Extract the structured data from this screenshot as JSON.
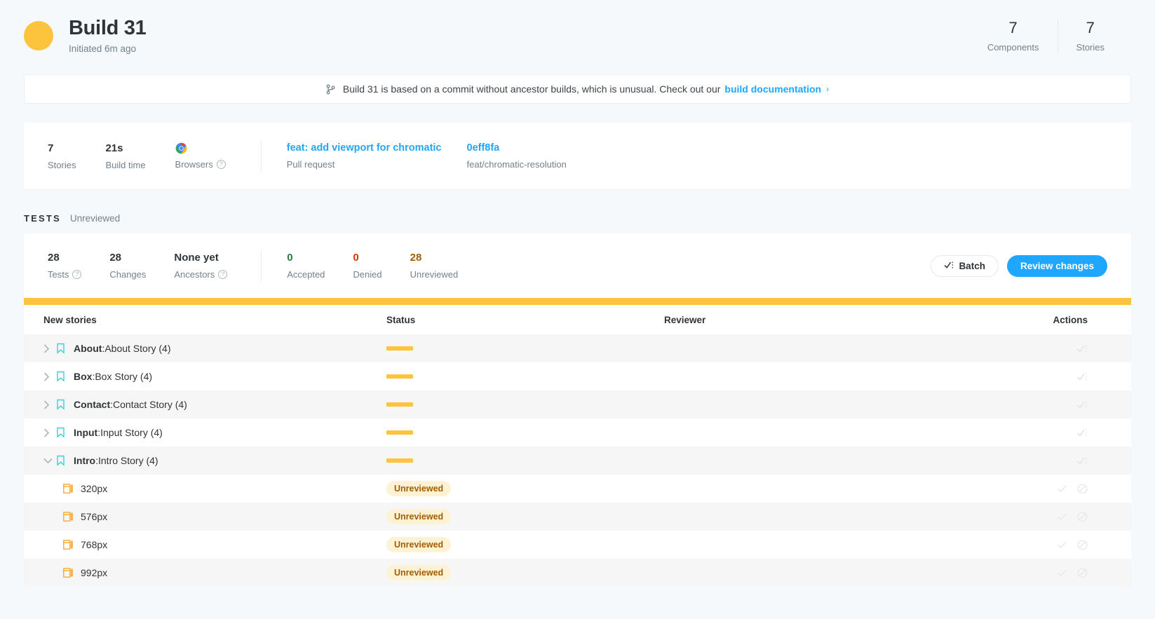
{
  "header": {
    "title": "Build 31",
    "subtitle": "Initiated 6m ago",
    "status_color": "#fcc43d",
    "stats": [
      {
        "value": "7",
        "label": "Components"
      },
      {
        "value": "7",
        "label": "Stories"
      }
    ]
  },
  "notice": {
    "icon": "branch-icon",
    "text": "Build 31 is based on a commit without ancestor builds, which is unusual. Check out our",
    "link_label": "build documentation",
    "chevron": "›"
  },
  "info_card": {
    "stats": [
      {
        "value": "7",
        "label": "Stories"
      },
      {
        "value": "21s",
        "label": "Build time"
      }
    ],
    "browsers": {
      "label": "Browsers",
      "icon": "chrome-icon",
      "help": "?"
    },
    "commit": {
      "title": "feat: add viewport for chromatic",
      "subtitle": "Pull request"
    },
    "branch": {
      "title": "0eff8fa",
      "subtitle": "feat/chromatic-resolution"
    }
  },
  "tests": {
    "heading": "TESTS",
    "state": "Unreviewed",
    "counters": [
      {
        "value": "28",
        "label": "Tests",
        "help": "?",
        "tone": "default"
      },
      {
        "value": "28",
        "label": "Changes",
        "help": "",
        "tone": "default"
      },
      {
        "value": "None yet",
        "label": "Ancestors",
        "help": "?",
        "tone": "default"
      },
      {
        "value": "0",
        "label": "Accepted",
        "help": "",
        "tone": "accepted"
      },
      {
        "value": "0",
        "label": "Denied",
        "help": "",
        "tone": "denied"
      },
      {
        "value": "28",
        "label": "Unreviewed",
        "help": "",
        "tone": "unreviewed"
      }
    ],
    "batch_button": "Batch",
    "review_button": "Review changes",
    "progress_color": "#fcc43d"
  },
  "table": {
    "columns": {
      "name": "New stories",
      "status": "Status",
      "reviewer": "Reviewer",
      "actions": "Actions"
    },
    "rows": [
      {
        "type": "group",
        "expanded": false,
        "component": "About",
        "story": "About Story (4)",
        "status": "bar",
        "alt": true
      },
      {
        "type": "group",
        "expanded": false,
        "component": "Box",
        "story": "Box Story (4)",
        "status": "bar",
        "alt": false
      },
      {
        "type": "group",
        "expanded": false,
        "component": "Contact",
        "story": "Contact Story (4)",
        "status": "bar",
        "alt": true
      },
      {
        "type": "group",
        "expanded": false,
        "component": "Input",
        "story": "Input Story (4)",
        "status": "bar",
        "alt": false
      },
      {
        "type": "group",
        "expanded": true,
        "component": "Intro",
        "story": "Intro Story (4)",
        "status": "bar",
        "alt": true
      },
      {
        "type": "child",
        "viewport": "320px",
        "status": "Unreviewed",
        "alt": false
      },
      {
        "type": "child",
        "viewport": "576px",
        "status": "Unreviewed",
        "alt": true
      },
      {
        "type": "child",
        "viewport": "768px",
        "status": "Unreviewed",
        "alt": false
      },
      {
        "type": "child",
        "viewport": "992px",
        "status": "Unreviewed",
        "alt": true
      }
    ]
  }
}
